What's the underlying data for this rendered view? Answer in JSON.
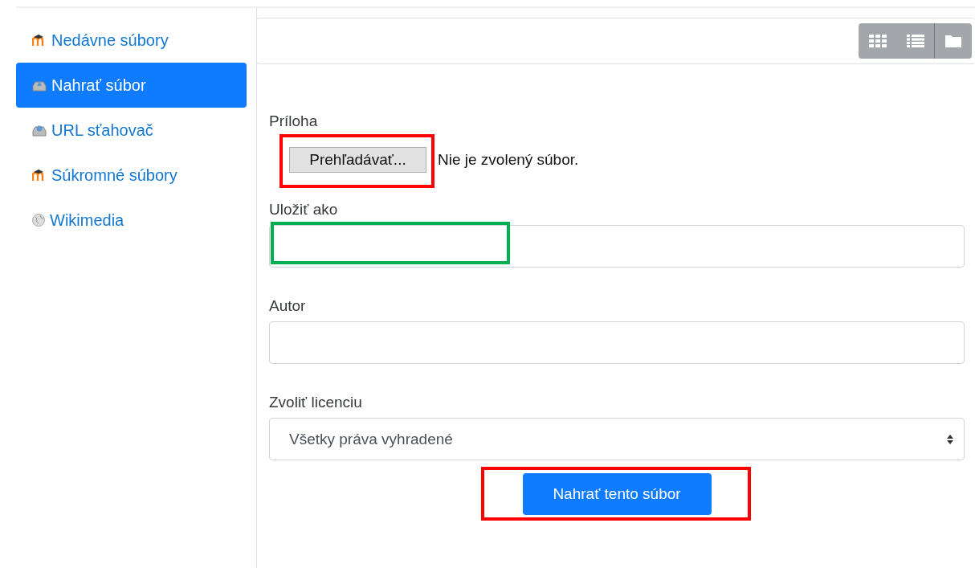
{
  "sidebar": {
    "items": [
      {
        "label": "Nedávne súbory",
        "kind": "moodle",
        "selected": false
      },
      {
        "label": "Nahrať súbor",
        "kind": "upload",
        "selected": true
      },
      {
        "label": "URL sťahovač",
        "kind": "url",
        "selected": false
      },
      {
        "label": "Súkromné súbory",
        "kind": "moodle",
        "selected": false
      },
      {
        "label": "Wikimedia",
        "kind": "wiki",
        "selected": false
      }
    ]
  },
  "toolbar": {
    "views": [
      {
        "kind": "grid"
      },
      {
        "kind": "list"
      },
      {
        "kind": "folder"
      }
    ]
  },
  "form": {
    "attachment": {
      "label": "Príloha",
      "button": "Prehľadávať...",
      "status": "Nie je zvolený súbor."
    },
    "save_as": {
      "label": "Uložiť ako"
    },
    "author": {
      "label": "Autor"
    },
    "license": {
      "label": "Zvoliť licenciu",
      "value": "Všetky práva vyhradené"
    },
    "submit": "Nahrať tento súbor"
  },
  "annotations": [
    {
      "color": "#ff0000"
    },
    {
      "color": "#00b050"
    },
    {
      "color": "#ff0000"
    }
  ]
}
